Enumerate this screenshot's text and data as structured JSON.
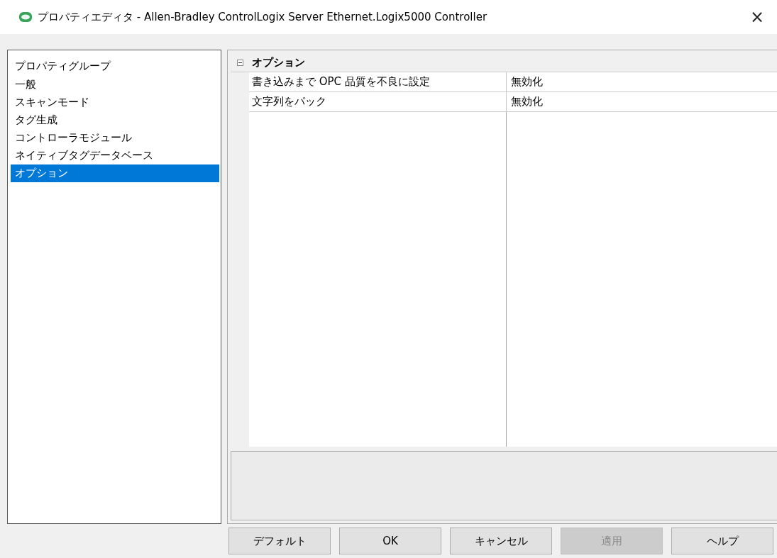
{
  "window": {
    "title": "プロパティエディタ - Allen-Bradley ControlLogix Server Ethernet.Logix5000 Controller",
    "close": "×"
  },
  "sidebar": {
    "heading": "プロパティグループ",
    "items": [
      {
        "label": "一般",
        "selected": false
      },
      {
        "label": "スキャンモード",
        "selected": false
      },
      {
        "label": "タグ生成",
        "selected": false
      },
      {
        "label": "コントローラモジュール",
        "selected": false
      },
      {
        "label": "ネイティブタグデータベース",
        "selected": false
      },
      {
        "label": "オプション",
        "selected": true
      }
    ]
  },
  "grid": {
    "group": {
      "title": "オプション",
      "expanded": true
    },
    "rows": [
      {
        "name": "書き込みまで OPC 品質を不良に設定",
        "value": "無効化"
      },
      {
        "name": "文字列をパック",
        "value": "無効化"
      }
    ]
  },
  "buttons": [
    {
      "label": "デフォルト",
      "disabled": false
    },
    {
      "label": "OK",
      "disabled": false
    },
    {
      "label": "キャンセル",
      "disabled": false
    },
    {
      "label": "適用",
      "disabled": true
    },
    {
      "label": "ヘルプ",
      "disabled": false
    }
  ]
}
